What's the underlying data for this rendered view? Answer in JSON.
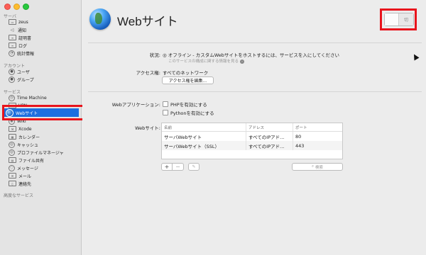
{
  "sidebar": {
    "section_server": "サーバ",
    "server_items": [
      {
        "label": "zeus",
        "icon": "server-icon"
      },
      {
        "label": "通知",
        "icon": "megaphone-icon"
      },
      {
        "label": "証明書",
        "icon": "certificate-icon"
      },
      {
        "label": "ログ",
        "icon": "log-icon"
      },
      {
        "label": "統計情報",
        "icon": "stats-icon"
      }
    ],
    "section_accounts": "アカウント",
    "account_items": [
      {
        "label": "ユーザ",
        "icon": "user-icon"
      },
      {
        "label": "グループ",
        "icon": "group-icon"
      }
    ],
    "section_services": "サービス",
    "service_items": [
      {
        "label": "Time Machine",
        "icon": "time-machine-icon"
      },
      {
        "label": "VPN",
        "icon": "vpn-icon"
      },
      {
        "label": "Webサイト",
        "icon": "globe-icon",
        "selected": true
      },
      {
        "label": "Wiki",
        "icon": "wiki-icon"
      },
      {
        "label": "Xcode",
        "icon": "xcode-icon"
      },
      {
        "label": "カレンダー",
        "icon": "calendar-icon"
      },
      {
        "label": "キャッシュ",
        "icon": "cache-icon"
      },
      {
        "label": "プロファイルマネージャ",
        "icon": "profile-manager-icon"
      },
      {
        "label": "ファイル共有",
        "icon": "file-sharing-icon"
      },
      {
        "label": "メッセージ",
        "icon": "messages-icon"
      },
      {
        "label": "メール",
        "icon": "mail-icon"
      },
      {
        "label": "連絡先",
        "icon": "contacts-icon"
      }
    ],
    "section_advanced": "高度なサービス"
  },
  "header": {
    "title": "Webサイト",
    "switch_label": "切"
  },
  "status": {
    "label": "状況:",
    "value": "◎ オフライン - カスタムWebサイトをホストするには、サービスを入にしてください",
    "sublink": "このサービスの構成に関する情報を見る"
  },
  "access": {
    "label": "アクセス権:",
    "value": "すべてのネットワーク",
    "edit_button": "アクセス権を編集..."
  },
  "web_apps": {
    "label": "Webアプリケーション:",
    "options": [
      {
        "label": "PHPを有効にする",
        "checked": false
      },
      {
        "label": "Pythonを有効にする",
        "checked": false
      }
    ]
  },
  "websites": {
    "label": "Webサイト:",
    "columns": [
      "名前",
      "アドレス",
      "ポート"
    ],
    "rows": [
      [
        "サーバWebサイト",
        "すべてのIPアド...",
        "80"
      ],
      [
        "サーバWebサイト（SSL）",
        "すべてのIPアド...",
        "443"
      ]
    ],
    "add_button": "+",
    "remove_button": "−",
    "edit_button": "✎",
    "search_placeholder": "検索"
  },
  "colors": {
    "selection": "#1c6fe0",
    "highlight_frame": "#e8141c"
  }
}
